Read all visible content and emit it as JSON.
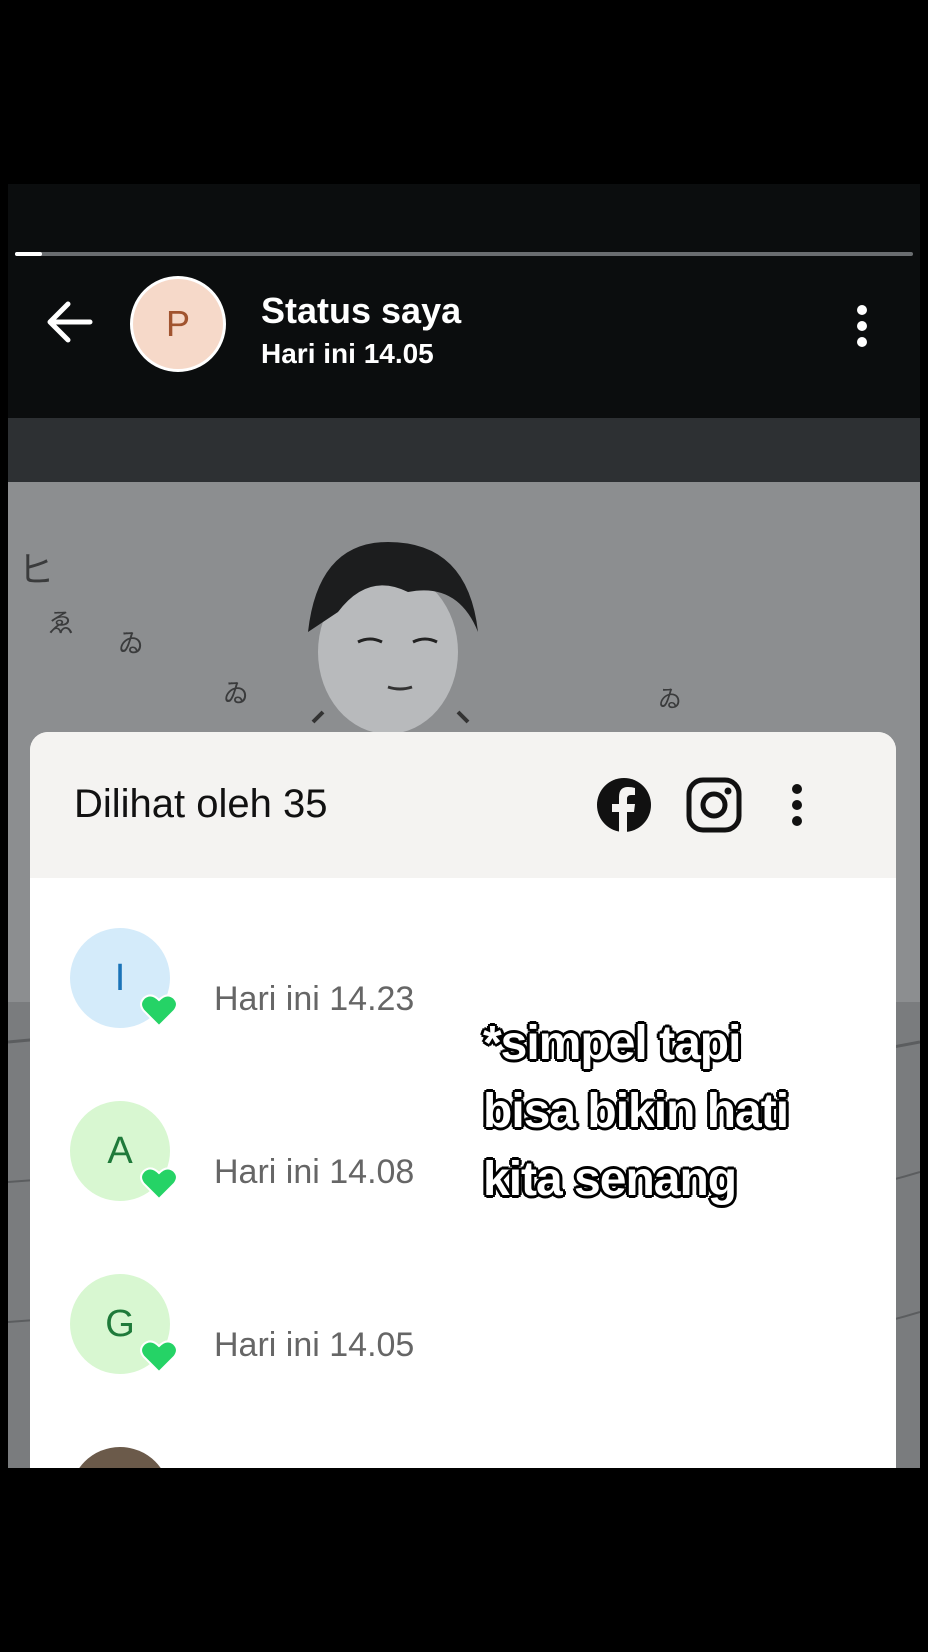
{
  "status": {
    "title": "Status saya",
    "time": "Hari ini 14.05",
    "avatar_letter": "P",
    "progress": 0.03
  },
  "viewers_sheet": {
    "header": "Dilihat oleh 35",
    "icons": [
      "facebook-icon",
      "instagram-icon",
      "more-vert-icon"
    ],
    "viewers": [
      {
        "letter": "I",
        "time": "Hari ini 14.23",
        "avatar_bg": "#d4ebfa",
        "avatar_fg": "#1a73b8"
      },
      {
        "letter": "A",
        "time": "Hari ini 14.08",
        "avatar_bg": "#d8f7d1",
        "avatar_fg": "#1f7a3a"
      },
      {
        "letter": "G",
        "time": "Hari ini 14.05",
        "avatar_bg": "#d8f7d1",
        "avatar_fg": "#1f7a3a"
      }
    ],
    "heart_color": "#25d366"
  },
  "caption": {
    "lines": [
      "*simpel tapi",
      "bisa bikin hati",
      "kita senang"
    ]
  }
}
